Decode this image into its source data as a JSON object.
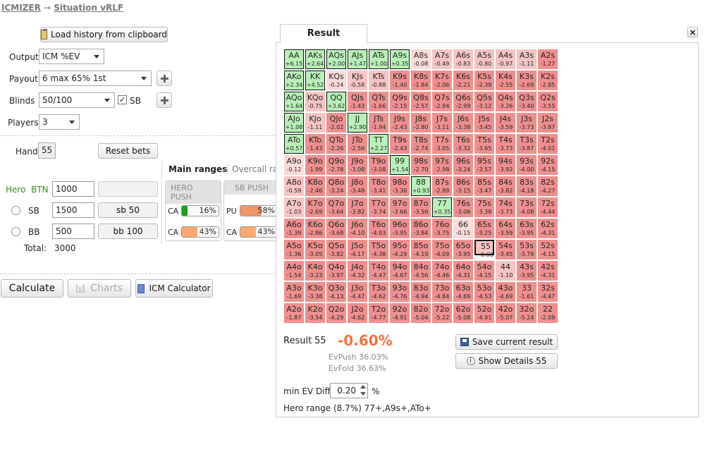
{
  "breadcrumb": {
    "root": "ICMIZER",
    "arrow": "→",
    "current": "Situation vRLF"
  },
  "toolbar": {
    "load_history": "Load history from clipboard"
  },
  "form": {
    "output_label": "Output",
    "output_value": "ICM %EV",
    "payout_label": "Payout",
    "payout_value": "6 max 65% 1st",
    "blinds_label": "Blinds",
    "blinds_value": "50/100",
    "sb_check_label": "SB",
    "players_label": "Players",
    "players_value": "3",
    "hand_label": "Hand",
    "hand_value": "55",
    "reset_bets": "Reset bets",
    "hero_label": "Hero",
    "btn_label": "BTN",
    "btn_stack": "1000",
    "sb_label": "SB",
    "sb_stack": "1500",
    "sb_bet": "sb 50",
    "bb_label": "BB",
    "bb_stack": "500",
    "bb_bet": "bb 100",
    "total_label": "Total:",
    "total_value": "3000"
  },
  "ranges": {
    "tab_main": "Main ranges",
    "tab_overcall": "Overcall ra",
    "hero_push_header": "HERO PUSH",
    "sb_push_header": "SB PUSH",
    "hero_row1_label": "CA",
    "hero_row1_pct": "16%",
    "hero_row1_fill": 0.16,
    "hero_row2_label": "CA",
    "hero_row2_pct": "43%",
    "hero_row2_fill": 0.43,
    "sb_row1_label": "PU",
    "sb_row1_pct": "58%",
    "sb_row1_fill": 0.58,
    "sb_row2_label": "CA",
    "sb_row2_pct": "43%",
    "sb_row2_fill": 0.43
  },
  "actions": {
    "calculate": "Calculate",
    "charts": "Charts",
    "icm_calculator": "ICM Calculator"
  },
  "result_panel": {
    "tab_label": "Result",
    "close": "×",
    "result_label": "Result",
    "result_hand": "55",
    "result_value": "-0.60%",
    "ev_push": "EvPush 36.03%",
    "ev_fold": "EvFold 36.63%",
    "save_button": "Save current result",
    "details_button": "Show Details 55",
    "min_ev_label": "min EV Diff",
    "min_ev_value": "0.20",
    "min_ev_unit": "%",
    "hero_range_label": "Hero range",
    "hero_range_value": "(8.7%) 77+,A9s+,ATo+"
  },
  "colors": {
    "positive": "#b8f0b8",
    "negative": "#ef8f8f",
    "negative_light": "#f6c4c4",
    "neutral": "#fbdada",
    "result_value": "#f27240",
    "hero_bar": "#1aa01a",
    "villain_bar": "#f8a870",
    "sb_push_bar": "#f2956b"
  },
  "grid": {
    "selected": "55",
    "rows": [
      [
        [
          "AA",
          "+6.15"
        ],
        [
          "AKs",
          "+2.64"
        ],
        [
          "AQs",
          "+2.00"
        ],
        [
          "AJs",
          "+1.47"
        ],
        [
          "ATs",
          "+1.00"
        ],
        [
          "A9s",
          "+0.35"
        ],
        [
          "A8s",
          "-0.08"
        ],
        [
          "A7s",
          "-0.49"
        ],
        [
          "A6s",
          "-0.83"
        ],
        [
          "A5s",
          "-0.80"
        ],
        [
          "A4s",
          "-0.97"
        ],
        [
          "A3s",
          "-1.11"
        ],
        [
          "A2s",
          "-1.27"
        ]
      ],
      [
        [
          "AKo",
          "+2.34"
        ],
        [
          "KK",
          "+4.52"
        ],
        [
          "KQs",
          "-0.24"
        ],
        [
          "KJs",
          "-0.58"
        ],
        [
          "KTs",
          "-0.88"
        ],
        [
          "K9s",
          "-1.40"
        ],
        [
          "K8s",
          "-1.84"
        ],
        [
          "K7s",
          "-2.06"
        ],
        [
          "K6s",
          "-2.21"
        ],
        [
          "K5s",
          "-2.39"
        ],
        [
          "K4s",
          "-2.55"
        ],
        [
          "K3s",
          "-2.69"
        ],
        [
          "K2s",
          "-2.85"
        ]
      ],
      [
        [
          "AQo",
          "+1.64"
        ],
        [
          "KQo",
          "-0.75"
        ],
        [
          "QQ",
          "+3.62"
        ],
        [
          "QJs",
          "-1.43"
        ],
        [
          "QTs",
          "-1.66"
        ],
        [
          "Q9s",
          "-2.15"
        ],
        [
          "Q8s",
          "-2.57"
        ],
        [
          "Q7s",
          "-2.94"
        ],
        [
          "Q6s",
          "-2.99"
        ],
        [
          "Q5s",
          "-3.12"
        ],
        [
          "Q4s",
          "-3.26"
        ],
        [
          "Q3s",
          "-3.40"
        ],
        [
          "Q2s",
          "-3.55"
        ]
      ],
      [
        [
          "AJo",
          "+1.08"
        ],
        [
          "KJo",
          "-1.11"
        ],
        [
          "QJo",
          "-2.02"
        ],
        [
          "JJ",
          "+2.90"
        ],
        [
          "JTs",
          "-1.94"
        ],
        [
          "J9s",
          "-2.43"
        ],
        [
          "J8s",
          "-2.80"
        ],
        [
          "J7s",
          "-3.11"
        ],
        [
          "J6s",
          "-3.38"
        ],
        [
          "J5s",
          "-3.45"
        ],
        [
          "J4s",
          "-3.59"
        ],
        [
          "J3s",
          "-3.73"
        ],
        [
          "J2s",
          "-3.87"
        ]
      ],
      [
        [
          "ATo",
          "+0.57"
        ],
        [
          "KTo",
          "-1.43"
        ],
        [
          "QTo",
          "-2.26"
        ],
        [
          "JTo",
          "-2.56"
        ],
        [
          "TT",
          "+2.27"
        ],
        [
          "T9s",
          "-2.43"
        ],
        [
          "T8s",
          "-2.74"
        ],
        [
          "T7s",
          "-3.05"
        ],
        [
          "T6s",
          "-3.32"
        ],
        [
          "T5s",
          "-3.65"
        ],
        [
          "T4s",
          "-3.73"
        ],
        [
          "T3s",
          "-3.87"
        ],
        [
          "T2s",
          "-4.01"
        ]
      ],
      [
        [
          "A9o",
          "-0.12"
        ],
        [
          "K9o",
          "-1.99"
        ],
        [
          "Q9o",
          "-2.78"
        ],
        [
          "J9o",
          "-3.08"
        ],
        [
          "T9o",
          "-3.08"
        ],
        [
          "99",
          "+1.54"
        ],
        [
          "98s",
          "-2.70"
        ],
        [
          "97s",
          "-2.98"
        ],
        [
          "96s",
          "-3.24"
        ],
        [
          "95s",
          "-3.57"
        ],
        [
          "94s",
          "-3.92"
        ],
        [
          "93s",
          "-4.00"
        ],
        [
          "92s",
          "-4.15"
        ]
      ],
      [
        [
          "A8o",
          "-0.59"
        ],
        [
          "K8o",
          "-2.46"
        ],
        [
          "Q8o",
          "-3.24"
        ],
        [
          "J8o",
          "-3.48"
        ],
        [
          "T8o",
          "-3.41"
        ],
        [
          "98o",
          "-3.36"
        ],
        [
          "88",
          "+0.93"
        ],
        [
          "87s",
          "-2.89"
        ],
        [
          "86s",
          "-3.15"
        ],
        [
          "85s",
          "-3.47"
        ],
        [
          "84s",
          "-3.82"
        ],
        [
          "83s",
          "-4.18"
        ],
        [
          "82s",
          "-4.27"
        ]
      ],
      [
        [
          "A7o",
          "-1.03"
        ],
        [
          "K7o",
          "-2.69"
        ],
        [
          "Q7o",
          "-3.64"
        ],
        [
          "J7o",
          "-3.82"
        ],
        [
          "T7o",
          "-3.74"
        ],
        [
          "97o",
          "-3.66"
        ],
        [
          "87o",
          "-3.56"
        ],
        [
          "77",
          "+0.35"
        ],
        [
          "76s",
          "-3.06"
        ],
        [
          "75s",
          "-3.38"
        ],
        [
          "74s",
          "-3.73"
        ],
        [
          "73s",
          "-4.08"
        ],
        [
          "72s",
          "-4.44"
        ]
      ],
      [
        [
          "A6o",
          "-1.39"
        ],
        [
          "K6o",
          "-2.86"
        ],
        [
          "Q6o",
          "-3.68"
        ],
        [
          "J6o",
          "-4.10"
        ],
        [
          "T6o",
          "-4.03"
        ],
        [
          "96o",
          "-3.95"
        ],
        [
          "86o",
          "-3.84"
        ],
        [
          "76o",
          "-3.75"
        ],
        [
          "66",
          "-0.15"
        ],
        [
          "65s",
          "-3.25"
        ],
        [
          "64s",
          "-3.59"
        ],
        [
          "63s",
          "-3.95"
        ],
        [
          "62s",
          "-4.31"
        ]
      ],
      [
        [
          "A5o",
          "-1.36"
        ],
        [
          "K5o",
          "-3.05"
        ],
        [
          "Q5o",
          "-3.82"
        ],
        [
          "J5o",
          "-4.17"
        ],
        [
          "T5o",
          "-4.38"
        ],
        [
          "95o",
          "-4.29"
        ],
        [
          "85o",
          "-4.19"
        ],
        [
          "75o",
          "-4.09"
        ],
        [
          "65o",
          "-3.95"
        ],
        [
          "55",
          "-0.60"
        ],
        [
          "54s",
          "-3.45"
        ],
        [
          "53s",
          "-3.79"
        ],
        [
          "52s",
          "-4.15"
        ]
      ],
      [
        [
          "A4o",
          "-1.54"
        ],
        [
          "K4o",
          "-3.23"
        ],
        [
          "Q4o",
          "-3.97"
        ],
        [
          "J4o",
          "-4.32"
        ],
        [
          "T4o",
          "-4.47"
        ],
        [
          "94o",
          "-4.67"
        ],
        [
          "84o",
          "-4.56"
        ],
        [
          "74o",
          "-4.46"
        ],
        [
          "64o",
          "-4.31"
        ],
        [
          "54o",
          "-4.15"
        ],
        [
          "44",
          "-1.10"
        ],
        [
          "43s",
          "-3.95"
        ],
        [
          "42s",
          "-4.31"
        ]
      ],
      [
        [
          "A3o",
          "-1.69"
        ],
        [
          "K3o",
          "-3.38"
        ],
        [
          "Q3o",
          "-4.13"
        ],
        [
          "J3o",
          "-4.47"
        ],
        [
          "T3o",
          "-4.62"
        ],
        [
          "93o",
          "-4.76"
        ],
        [
          "83o",
          "-4.94"
        ],
        [
          "73o",
          "-4.84"
        ],
        [
          "63o",
          "-4.69"
        ],
        [
          "53o",
          "-4.53"
        ],
        [
          "43o",
          "-4.69"
        ],
        [
          "33",
          "-1.61"
        ],
        [
          "32s",
          "-4.47"
        ]
      ],
      [
        [
          "A2o",
          "-1.87"
        ],
        [
          "K2o",
          "-3.54"
        ],
        [
          "Q2o",
          "-4.29"
        ],
        [
          "J2o",
          "-4.62"
        ],
        [
          "T2o",
          "-4.77"
        ],
        [
          "92o",
          "-4.91"
        ],
        [
          "82o",
          "-5.04"
        ],
        [
          "72o",
          "-5.22"
        ],
        [
          "62o",
          "-5.08"
        ],
        [
          "52o",
          "-4.91"
        ],
        [
          "42o",
          "-5.07"
        ],
        [
          "32o",
          "-5.24"
        ],
        [
          "22",
          "-2.09"
        ]
      ]
    ]
  }
}
